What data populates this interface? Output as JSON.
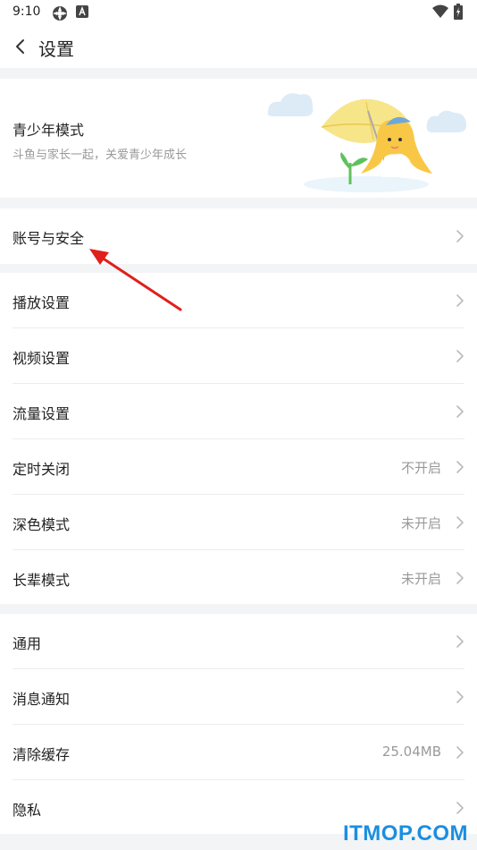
{
  "status_bar": {
    "time": "9:10",
    "icons": [
      "sync-icon",
      "a-icon",
      "wifi-icon",
      "battery-icon"
    ]
  },
  "header": {
    "title": "设置"
  },
  "youth": {
    "title": "青少年模式",
    "subtitle": "斗鱼与家长一起，关爱青少年成长"
  },
  "account": {
    "label": "账号与安全"
  },
  "playback_group": [
    {
      "label": "播放设置",
      "value": ""
    },
    {
      "label": "视频设置",
      "value": ""
    },
    {
      "label": "流量设置",
      "value": ""
    },
    {
      "label": "定时关闭",
      "value": "不开启"
    },
    {
      "label": "深色模式",
      "value": "未开启"
    },
    {
      "label": "长辈模式",
      "value": "未开启"
    }
  ],
  "general_group": [
    {
      "label": "通用",
      "value": ""
    },
    {
      "label": "消息通知",
      "value": ""
    },
    {
      "label": "清除缓存",
      "value": "25.04MB"
    },
    {
      "label": "隐私",
      "value": ""
    }
  ],
  "watermark": "ITMOP.COM",
  "colors": {
    "accent_arrow": "#e0201b",
    "watermark": "#1a8fe0",
    "umbrella": "#f7e58a"
  }
}
